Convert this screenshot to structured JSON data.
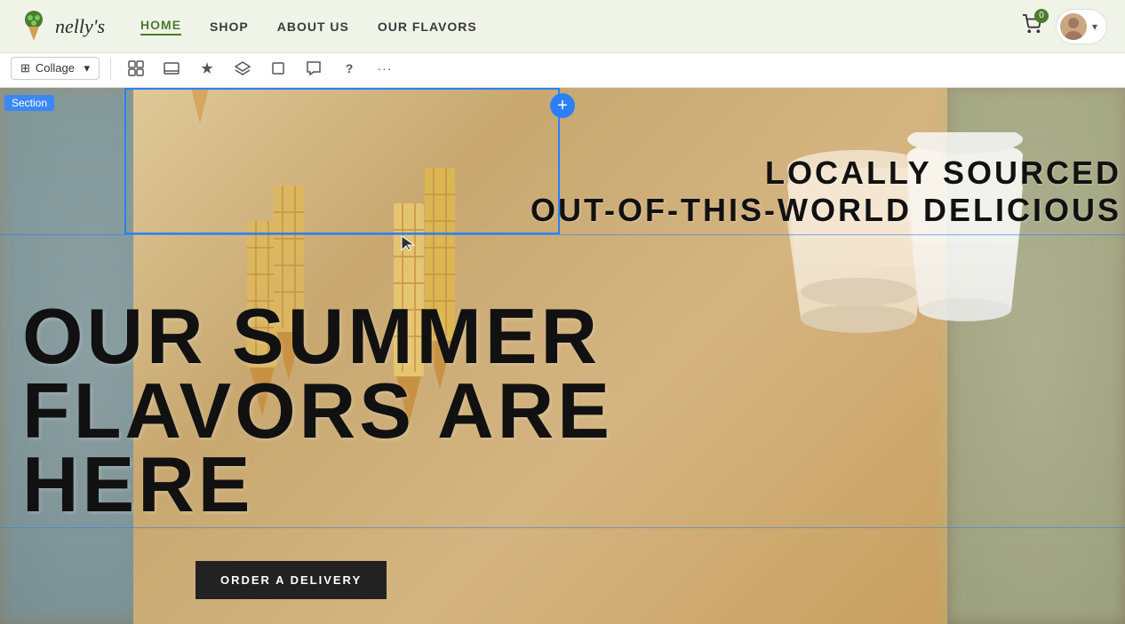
{
  "navbar": {
    "logo_text": "nelly's",
    "nav_items": [
      {
        "label": "HOME",
        "active": true
      },
      {
        "label": "SHOP",
        "active": false
      },
      {
        "label": "ABOUT US",
        "active": false
      },
      {
        "label": "OUR FLAVORS",
        "active": false
      }
    ],
    "cart_count": "0",
    "chevron": "▾"
  },
  "editor_toolbar": {
    "collage_label": "Collage",
    "icons": [
      {
        "name": "grid-layout-icon",
        "symbol": "⊞"
      },
      {
        "name": "preview-icon",
        "symbol": "▭"
      },
      {
        "name": "ai-icon",
        "symbol": "✦"
      },
      {
        "name": "layers-icon",
        "symbol": "◈"
      },
      {
        "name": "crop-icon",
        "symbol": "⬜"
      },
      {
        "name": "comment-icon",
        "symbol": "💬"
      },
      {
        "name": "help-icon",
        "symbol": "?"
      },
      {
        "name": "more-icon",
        "symbol": "···"
      }
    ]
  },
  "section_label": "Section",
  "add_button_symbol": "+",
  "hero": {
    "tagline_line1": "LOCALLY SOURCED",
    "tagline_line2": "OUT-OF-THIS-WORLD DELICIOUS",
    "main_heading_line1": "OUR SUMMER",
    "main_heading_line2": "FLAVORS ARE",
    "main_heading_line3": "HERE",
    "cta_label": "ORDER A DELIVERY"
  },
  "colors": {
    "accent_blue": "#2d7ff9",
    "nav_green": "#4a7c2f",
    "hero_text": "#111111",
    "cta_bg": "#222222",
    "cta_text": "#ffffff",
    "section_badge": "#3b87f5"
  }
}
